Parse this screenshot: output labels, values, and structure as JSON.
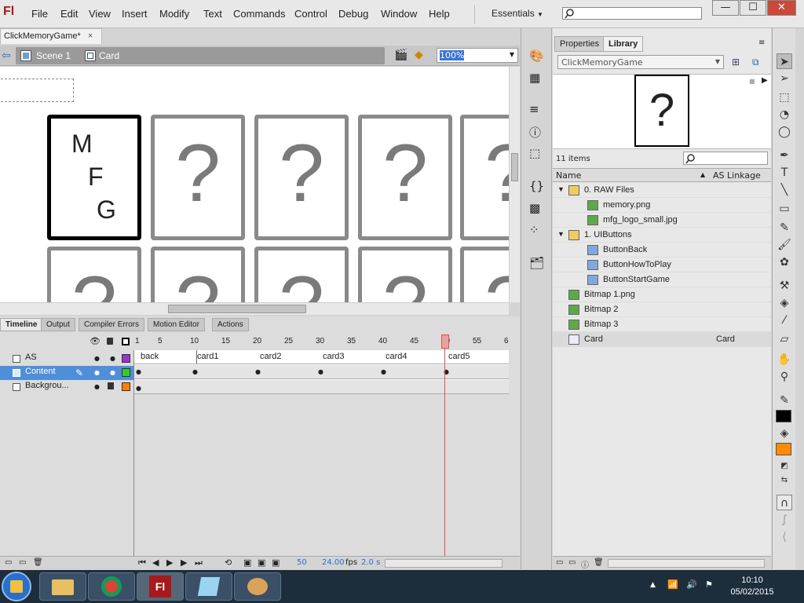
{
  "app": {
    "logo": "Fl",
    "doc_tab": "ClickMemoryGame*",
    "doc_close": "×"
  },
  "menu": [
    "File",
    "Edit",
    "View",
    "Insert",
    "Modify",
    "Text",
    "Commands",
    "Control",
    "Debug",
    "Window",
    "Help"
  ],
  "workspace": "Essentials",
  "window_controls": {
    "minimize": "—",
    "maximize": "☐",
    "close": "✕"
  },
  "editbar": {
    "scene": "Scene 1",
    "symbol": "Card",
    "zoom": "100%"
  },
  "stage": {
    "logo_card": [
      "M",
      "F",
      "G"
    ],
    "question": "?"
  },
  "timeline": {
    "tabs": [
      "Timeline",
      "Output",
      "Compiler Errors",
      "Motion Editor",
      "Actions"
    ],
    "ruler": [
      "1",
      "5",
      "10",
      "15",
      "20",
      "25",
      "30",
      "35",
      "40",
      "45",
      "50",
      "55",
      "6"
    ],
    "layers": [
      "AS",
      "Content",
      "Backgrou..."
    ],
    "labels": [
      "back",
      "card1",
      "card2",
      "card3",
      "card4",
      "card5"
    ],
    "status": {
      "frame": "50",
      "fps": "24.00",
      "fps_unit": "fps",
      "time": "2.0 s"
    }
  },
  "library": {
    "tabs": [
      "Properties",
      "Library"
    ],
    "doc": "ClickMemoryGame",
    "preview": "?",
    "count": "11 items",
    "col_name": "Name",
    "col_linkage": "AS Linkage",
    "items": [
      {
        "name": "0. RAW Files",
        "type": "folder",
        "level": 0,
        "linkage": ""
      },
      {
        "name": "memory.png",
        "type": "bitmap",
        "level": 1,
        "linkage": ""
      },
      {
        "name": "mfg_logo_small.jpg",
        "type": "bitmap",
        "level": 1,
        "linkage": ""
      },
      {
        "name": "1. UIButtons",
        "type": "folder",
        "level": 0,
        "linkage": ""
      },
      {
        "name": "ButtonBack",
        "type": "button",
        "level": 1,
        "linkage": ""
      },
      {
        "name": "ButtonHowToPlay",
        "type": "button",
        "level": 1,
        "linkage": ""
      },
      {
        "name": "ButtonStartGame",
        "type": "button",
        "level": 1,
        "linkage": ""
      },
      {
        "name": "Bitmap 1.png",
        "type": "bitmap",
        "level": 0,
        "linkage": ""
      },
      {
        "name": "Bitmap 2",
        "type": "bitmap",
        "level": 0,
        "linkage": ""
      },
      {
        "name": "Bitmap 3",
        "type": "bitmap",
        "level": 0,
        "linkage": ""
      },
      {
        "name": "Card",
        "type": "movieclip",
        "level": 0,
        "linkage": "Card"
      }
    ]
  },
  "taskbar": {
    "time": "10:10",
    "date": "05/02/2015"
  },
  "colors": {
    "accent": "#3875d7",
    "playhead": "#d9534f",
    "stroke": "#000000",
    "fill": "#ff8c00",
    "layer_as": "#9933cc",
    "layer_content": "#33cc33",
    "layer_bg": "#ff8000"
  }
}
